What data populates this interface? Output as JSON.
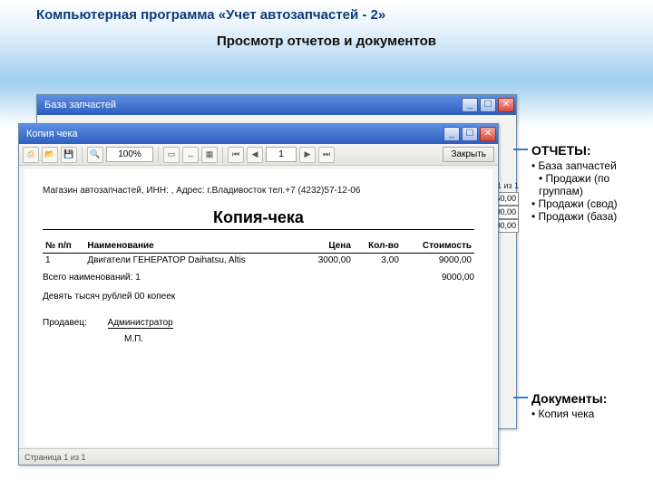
{
  "page": {
    "title": "Компьютерная программа «Учет автозапчастей - 2»",
    "subtitle": "Просмотр отчетов и документов"
  },
  "side_reports": {
    "heading": "ОТЧЕТЫ:",
    "items": [
      {
        "label": "База запчастей"
      },
      {
        "label": "Продажи (по группам)",
        "sub": true
      },
      {
        "label": "Продажи (свод)"
      },
      {
        "label": "Продажи (база)"
      }
    ]
  },
  "side_docs": {
    "heading": "Документы:",
    "items": [
      {
        "label": "Копия чека"
      }
    ]
  },
  "back_window": {
    "caption": "База запчастей",
    "page_indicator": "т 1 из 1",
    "cells": [
      "2 750,00",
      "5 200,00",
      "6 100,00"
    ]
  },
  "front_window": {
    "caption": "Копия чека",
    "zoom": "100%",
    "page_field": "1",
    "close_label": "Закрыть",
    "status": "Страница 1 из 1"
  },
  "doc": {
    "shop_info": "Магазин автозапчастей, ИНН: , Адрес: г.Владивосток тел.+7 (4232)57-12-06",
    "title": "Копия-чека",
    "columns": {
      "num": "№ п/п",
      "name": "Наименование",
      "price": "Цена",
      "qty": "Кол-во",
      "cost": "Стоимость"
    },
    "rows": [
      {
        "num": "1",
        "name": "Двигатели ГЕНЕРАТОР Daihatsu, Altis",
        "price": "3000,00",
        "qty": "3,00",
        "cost": "9000,00"
      }
    ],
    "total_line_label": "Всего наименований: 1",
    "total_cost": "9000,00",
    "amount_words": "Девять тысяч рублей 00 копеек",
    "seller_label": "Продавец:",
    "seller_name": "Администратор",
    "mp": "М.П."
  },
  "icons": {
    "min": "_",
    "max": "☐",
    "close": "✕",
    "print": "⎙",
    "open": "📂",
    "save": "💾",
    "find": "🔍",
    "first": "⏮",
    "prev": "◀",
    "next": "▶",
    "last": "⏭"
  }
}
